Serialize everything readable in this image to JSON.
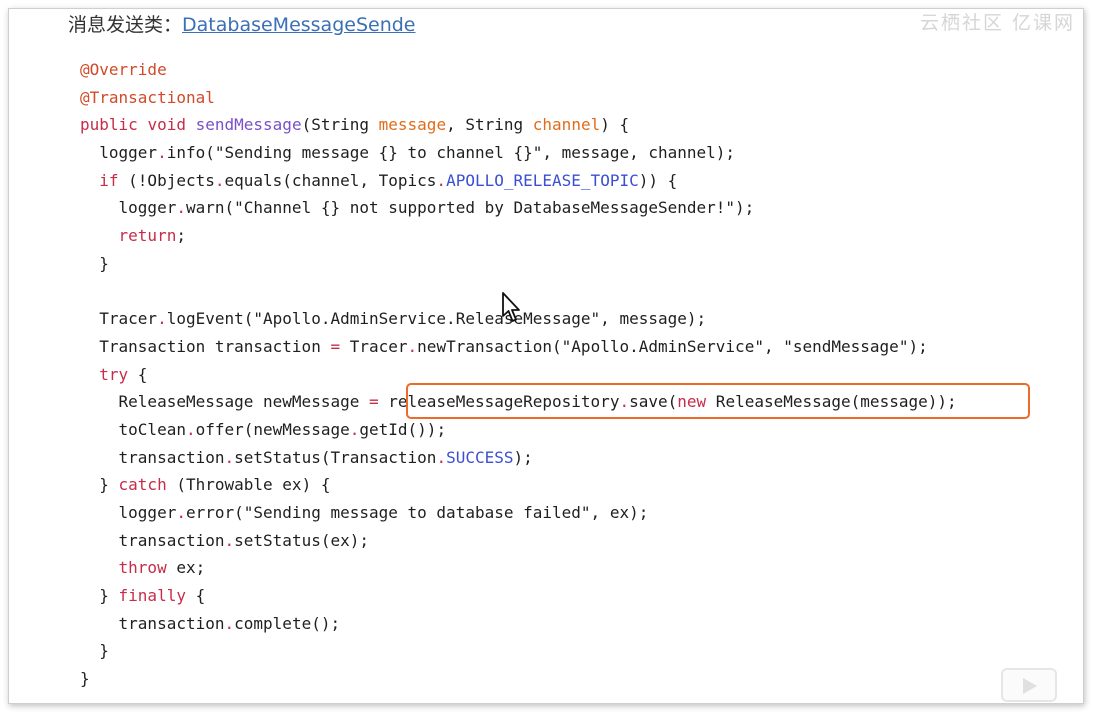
{
  "header": {
    "label": "消息发送类：",
    "link_text": "DatabaseMessageSende"
  },
  "watermark": {
    "text": "云栖社区 亿课网"
  },
  "code": {
    "lines": [
      [
        {
          "t": "@Override",
          "c": "an"
        }
      ],
      [
        {
          "t": "@Transactional",
          "c": "an"
        }
      ],
      [
        {
          "t": "public ",
          "c": "kw"
        },
        {
          "t": "void ",
          "c": "kw"
        },
        {
          "t": "sendMessage",
          "c": "fn"
        },
        {
          "t": "(String ",
          "c": ""
        },
        {
          "t": "message",
          "c": "param"
        },
        {
          "t": ", String ",
          "c": ""
        },
        {
          "t": "channel",
          "c": "param"
        },
        {
          "t": ") {",
          "c": ""
        }
      ],
      [
        {
          "t": "  logger",
          "c": ""
        },
        {
          "t": ".",
          "c": "dot"
        },
        {
          "t": "info(\"Sending message {} to channel {}\", message, channel);",
          "c": ""
        }
      ],
      [
        {
          "t": "  ",
          "c": ""
        },
        {
          "t": "if",
          "c": "kw"
        },
        {
          "t": " (!Objects",
          "c": ""
        },
        {
          "t": ".",
          "c": "dot"
        },
        {
          "t": "equals(channel, Topics",
          "c": ""
        },
        {
          "t": ".",
          "c": "dot"
        },
        {
          "t": "APOLLO_RELEASE_TOPIC",
          "c": "const"
        },
        {
          "t": ")) {",
          "c": ""
        }
      ],
      [
        {
          "t": "    logger",
          "c": ""
        },
        {
          "t": ".",
          "c": "dot"
        },
        {
          "t": "warn(\"Channel {} not supported by DatabaseMessageSender!\");",
          "c": ""
        }
      ],
      [
        {
          "t": "    ",
          "c": ""
        },
        {
          "t": "return",
          "c": "kw"
        },
        {
          "t": ";",
          "c": ""
        }
      ],
      [
        {
          "t": "  }",
          "c": ""
        }
      ],
      [
        {
          "t": "",
          "c": ""
        }
      ],
      [
        {
          "t": "  Tracer",
          "c": ""
        },
        {
          "t": ".",
          "c": "dot"
        },
        {
          "t": "logEvent(\"Apollo.AdminService.ReleaseMessage\", message);",
          "c": ""
        }
      ],
      [
        {
          "t": "  Transaction transaction ",
          "c": ""
        },
        {
          "t": "=",
          "c": "dot"
        },
        {
          "t": " Tracer",
          "c": ""
        },
        {
          "t": ".",
          "c": "dot"
        },
        {
          "t": "newTransaction(\"Apollo.AdminService\", \"sendMessage\");",
          "c": ""
        }
      ],
      [
        {
          "t": "  ",
          "c": ""
        },
        {
          "t": "try",
          "c": "kw"
        },
        {
          "t": " {",
          "c": ""
        }
      ],
      [
        {
          "t": "    ReleaseMessage newMessage ",
          "c": ""
        },
        {
          "t": "=",
          "c": "dot"
        },
        {
          "t": " releaseMessageRepository",
          "c": ""
        },
        {
          "t": ".",
          "c": "dot"
        },
        {
          "t": "save(",
          "c": ""
        },
        {
          "t": "new",
          "c": "kw"
        },
        {
          "t": " ReleaseMessage(message));",
          "c": ""
        }
      ],
      [
        {
          "t": "    toClean",
          "c": ""
        },
        {
          "t": ".",
          "c": "dot"
        },
        {
          "t": "offer(newMessage",
          "c": ""
        },
        {
          "t": ".",
          "c": "dot"
        },
        {
          "t": "getId());",
          "c": ""
        }
      ],
      [
        {
          "t": "    transaction",
          "c": ""
        },
        {
          "t": ".",
          "c": "dot"
        },
        {
          "t": "setStatus(Transaction",
          "c": ""
        },
        {
          "t": ".",
          "c": "dot"
        },
        {
          "t": "SUCCESS",
          "c": "const"
        },
        {
          "t": ");",
          "c": ""
        }
      ],
      [
        {
          "t": "  } ",
          "c": ""
        },
        {
          "t": "catch",
          "c": "kw"
        },
        {
          "t": " (Throwable ex) {",
          "c": ""
        }
      ],
      [
        {
          "t": "    logger",
          "c": ""
        },
        {
          "t": ".",
          "c": "dot"
        },
        {
          "t": "error(\"Sending message to database failed\", ex);",
          "c": ""
        }
      ],
      [
        {
          "t": "    transaction",
          "c": ""
        },
        {
          "t": ".",
          "c": "dot"
        },
        {
          "t": "setStatus(ex);",
          "c": ""
        }
      ],
      [
        {
          "t": "    ",
          "c": ""
        },
        {
          "t": "throw",
          "c": "kw"
        },
        {
          "t": " ex;",
          "c": ""
        }
      ],
      [
        {
          "t": "  } ",
          "c": ""
        },
        {
          "t": "finally",
          "c": "kw"
        },
        {
          "t": " {",
          "c": ""
        }
      ],
      [
        {
          "t": "    transaction",
          "c": ""
        },
        {
          "t": ".",
          "c": "dot"
        },
        {
          "t": "complete();",
          "c": ""
        }
      ],
      [
        {
          "t": "  }",
          "c": ""
        }
      ],
      [
        {
          "t": "}",
          "c": ""
        }
      ]
    ]
  },
  "highlight_color": "#ec6a2a"
}
